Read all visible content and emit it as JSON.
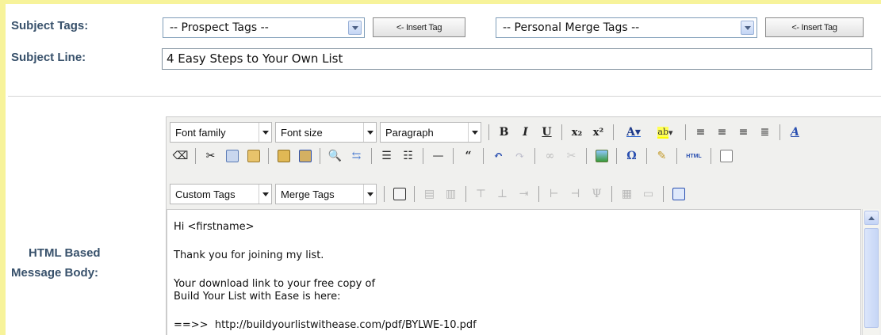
{
  "subject_tags": {
    "label": "Subject Tags:",
    "prospect_select": "-- Prospect Tags --",
    "insert_btn_1": "<- Insert Tag",
    "merge_select": "-- Personal Merge Tags --",
    "insert_btn_2": "<- Insert Tag"
  },
  "subject_line": {
    "label": "Subject Line:",
    "value": "4 Easy Steps to Your Own List"
  },
  "message_body": {
    "label_line1": "HTML Based",
    "label_line2": "Message Body:"
  },
  "toolbar": {
    "font_family": "Font family",
    "font_size": "Font size",
    "format": "Paragraph",
    "custom_tags": "Custom Tags",
    "merge_tags": "Merge Tags",
    "bold": "B",
    "italic": "I",
    "underline": "U"
  },
  "editor_content": {
    "line1": "Hi <firstname>",
    "line2": "Thank you for joining my list.",
    "line3": "Your download link to your free copy of",
    "line4": "Build Your List with Ease is here:",
    "line5": "==>>  http://buildyourlistwithease.com/pdf/BYLWE-10.pdf"
  },
  "colors": {
    "label": "#38516b",
    "frame": "#f7f39a",
    "toolbar_bg": "#f0f0ee"
  }
}
